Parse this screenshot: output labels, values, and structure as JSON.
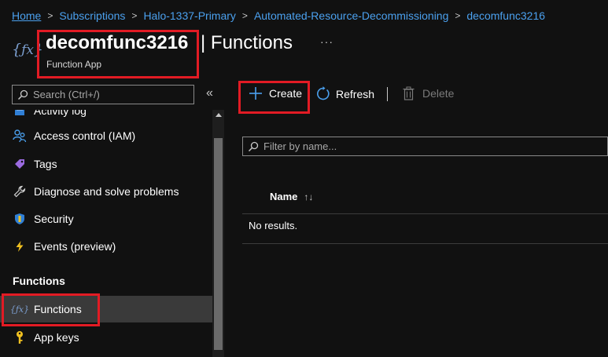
{
  "breadcrumb": {
    "items": [
      "Home",
      "Subscriptions",
      "Halo-1337-Primary",
      "Automated-Resource-Decommissioning",
      "decomfunc3216"
    ]
  },
  "header": {
    "icon": "function-app-icon",
    "title": "decomfunc3216",
    "divider": "|",
    "section": "Functions",
    "subtitle": "Function App",
    "more": "···"
  },
  "sidebar": {
    "search_placeholder": "Search (Ctrl+/)",
    "collapse": "«",
    "items": [
      {
        "label": "Activity log",
        "icon": "activity-log-icon"
      },
      {
        "label": "Access control (IAM)",
        "icon": "iam-people-icon"
      },
      {
        "label": "Tags",
        "icon": "tag-icon"
      },
      {
        "label": "Diagnose and solve problems",
        "icon": "wrench-icon"
      },
      {
        "label": "Security",
        "icon": "shield-icon"
      },
      {
        "label": "Events (preview)",
        "icon": "lightning-icon"
      }
    ],
    "section_heading": "Functions",
    "section_items": [
      {
        "label": "Functions",
        "icon": "function-icon",
        "active": true
      },
      {
        "label": "App keys",
        "icon": "key-icon"
      }
    ]
  },
  "toolbar": {
    "create_label": "Create",
    "refresh_label": "Refresh",
    "delete_label": "Delete"
  },
  "filter": {
    "placeholder": "Filter by name..."
  },
  "table": {
    "columns": [
      "Name"
    ],
    "sort_icon": "↑↓",
    "empty_text": "No results."
  },
  "colors": {
    "background": "#111111",
    "link": "#4ba0ee",
    "highlight_box": "#e21b24",
    "active_row": "#3a3a3a"
  }
}
